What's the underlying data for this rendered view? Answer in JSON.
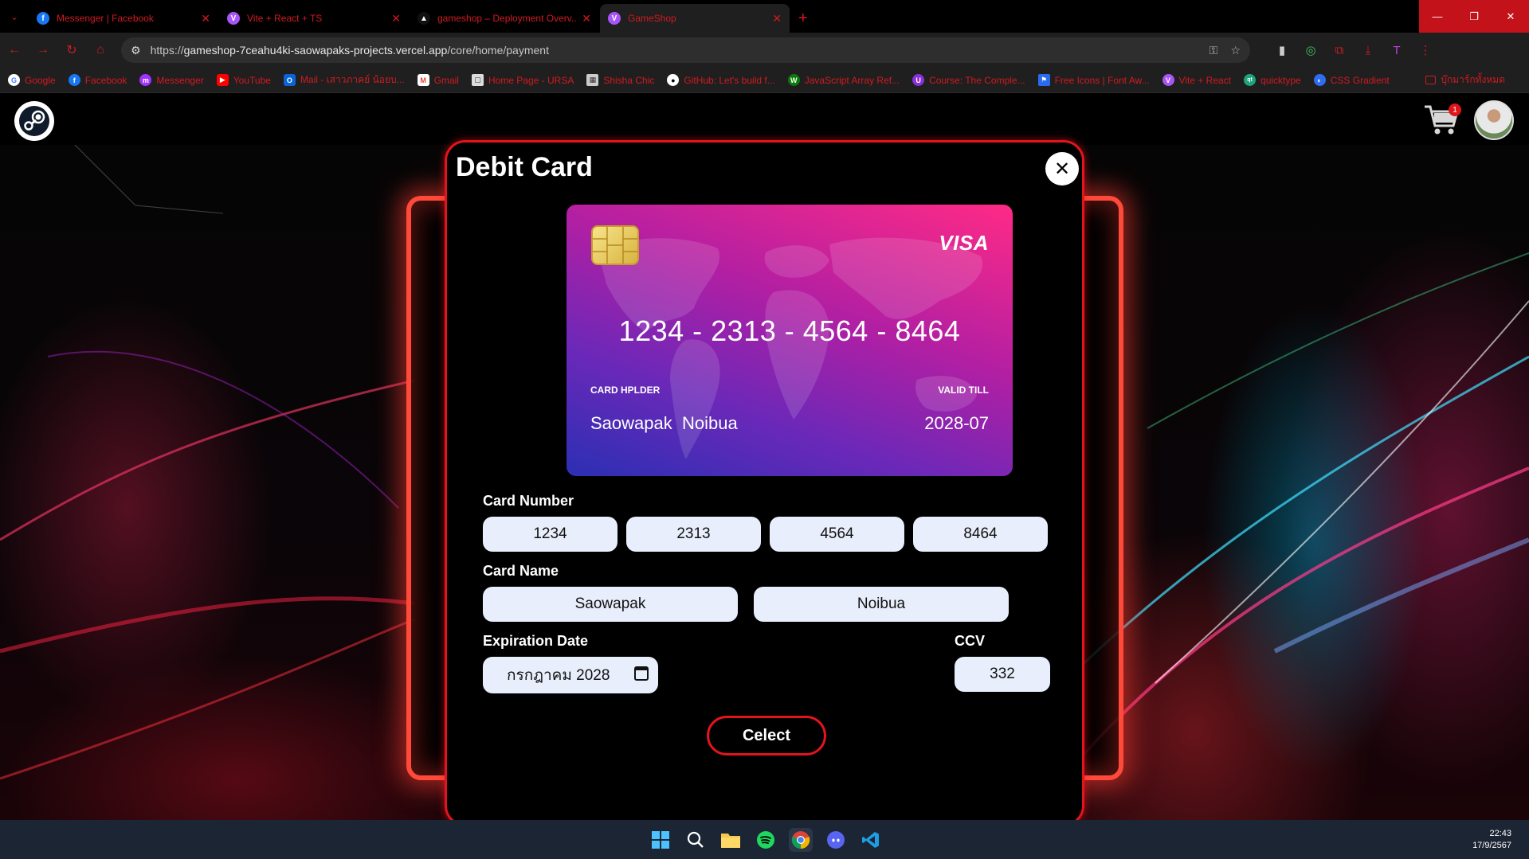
{
  "browser": {
    "tabs": [
      {
        "title": "Messenger | Facebook",
        "icon": "facebook-icon",
        "color": "#1877f2",
        "glyph": "f"
      },
      {
        "title": "Vite + React + TS",
        "icon": "vite-icon",
        "color": "#a855f7",
        "glyph": "V"
      },
      {
        "title": "gameshop – Deployment Overv...",
        "icon": "vercel-icon",
        "color": "#111111",
        "glyph": "▲"
      },
      {
        "title": "GameShop",
        "icon": "vite-icon",
        "color": "#a855f7",
        "glyph": "V"
      }
    ],
    "url_prefix": "https://",
    "url_host": "gameshop-7ceahu4ki-saowapaks-projects.vercel.app",
    "url_path": "/core/home/payment",
    "bookmarks": [
      {
        "label": "Google",
        "color": "#ffffff",
        "glyph": "G"
      },
      {
        "label": "Facebook",
        "color": "#1877f2",
        "glyph": "f"
      },
      {
        "label": "Messenger",
        "color": "#a033ff",
        "glyph": "m"
      },
      {
        "label": "YouTube",
        "color": "#ff0000",
        "glyph": "▶"
      },
      {
        "label": "Mail - เสาวภาคย์ น้อยบ...",
        "color": "#0a64d6",
        "glyph": "O"
      },
      {
        "label": "Gmail",
        "color": "#ea4335",
        "glyph": "M"
      },
      {
        "label": "Home Page - URSA",
        "color": "#dddddd",
        "glyph": "▢"
      },
      {
        "label": "Shisha Chic",
        "color": "#cccccc",
        "glyph": "▦"
      },
      {
        "label": "GitHub: Let's build f...",
        "color": "#ffffff",
        "glyph": "●"
      },
      {
        "label": "JavaScript Array Ref...",
        "color": "#0a7a0a",
        "glyph": "W"
      },
      {
        "label": "Course: The Comple...",
        "color": "#8b30d6",
        "glyph": "U"
      },
      {
        "label": "Free Icons | Font Aw...",
        "color": "#2a6cf0",
        "glyph": "⚑"
      },
      {
        "label": "Vite + React",
        "color": "#a855f7",
        "glyph": "V"
      },
      {
        "label": "quicktype",
        "color": "#1fa37a",
        "glyph": "qt"
      },
      {
        "label": "CSS Gradient",
        "color": "#2f6df0",
        "glyph": "◐"
      }
    ],
    "bookmarks_folder": "บุ๊กมาร์กทั้งหมด"
  },
  "app": {
    "cart_count": "1",
    "modal": {
      "title": "Debit Card",
      "card": {
        "brand": "VISA",
        "number": "1234 - 2313 - 4564 - 8464",
        "holder_label": "CARD HPLDER",
        "valid_label": "VALID TILL",
        "holder_name": "Saowapak  Noibua",
        "valid_date": "2028-07"
      },
      "form": {
        "card_number_label": "Card Number",
        "card_number": [
          "1234",
          "2313",
          "4564",
          "8464"
        ],
        "card_name_label": "Card Name",
        "first_name": "Saowapak",
        "last_name": "Noibua",
        "expiration_label": "Expiration Date",
        "expiration_value": "กรกฎาคม 2028",
        "ccv_label": "CCV",
        "ccv_value": "332",
        "submit_label": "Celect"
      }
    }
  },
  "taskbar": {
    "time": "22:43",
    "date": "17/9/2567"
  }
}
